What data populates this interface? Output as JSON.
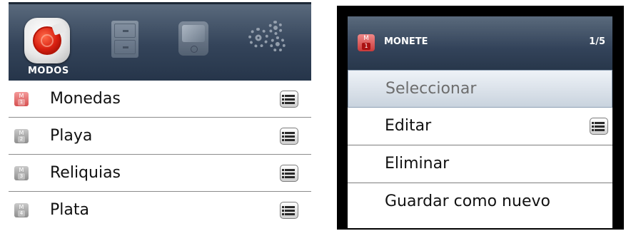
{
  "left_panel": {
    "header": {
      "active_tab_label": "MODOS",
      "tabs": [
        {
          "icon": "modes-coin-icon"
        },
        {
          "icon": "file-cabinet-icon"
        },
        {
          "icon": "device-icon"
        },
        {
          "icon": "gears-icon"
        }
      ]
    },
    "modes": [
      {
        "number": "1",
        "badge_letter": "M",
        "label": "Monedas",
        "active": true
      },
      {
        "number": "2",
        "badge_letter": "M",
        "label": "Playa",
        "active": false
      },
      {
        "number": "3",
        "badge_letter": "M",
        "label": "Reliquias",
        "active": false
      },
      {
        "number": "4",
        "badge_letter": "M",
        "label": "Plata",
        "active": false
      }
    ]
  },
  "right_panel": {
    "dialog": {
      "badge_letter": "M",
      "badge_number": "1",
      "title": "MONETE",
      "page_indicator": "1/5",
      "items": [
        {
          "label": "Seleccionar",
          "selected": true
        },
        {
          "label": "Editar",
          "has_list_icon": true
        },
        {
          "label": "Eliminar"
        },
        {
          "label": "Guardar como nuevo"
        }
      ]
    }
  },
  "colors": {
    "header_top": "#5b6b7e",
    "header_bottom": "#26354a",
    "active_mode_badge": "#d65050",
    "inactive_mode_badge": "#8d8d8d",
    "selected_item_bg": "#c9d3de"
  }
}
